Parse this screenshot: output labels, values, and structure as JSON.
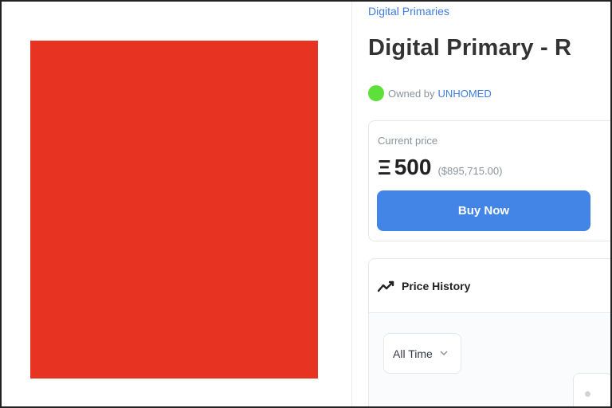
{
  "collection": {
    "name": "Digital Primaries"
  },
  "item": {
    "title": "Digital Primary - R"
  },
  "owner": {
    "prefix": "Owned by",
    "name": "UNHOMED"
  },
  "price": {
    "label": "Current price",
    "currency_symbol": "Ξ",
    "amount": "500",
    "usd": "($895,715.00)",
    "buy_label": "Buy Now"
  },
  "history": {
    "title": "Price History",
    "range_selected": "All Time"
  },
  "colors": {
    "artwork": "#e63322",
    "accent": "#4285e6",
    "link": "#3d7ddb",
    "owner_avatar": "#5ee03a"
  },
  "icons": [
    "trend-line-icon",
    "chevron-down-icon",
    "ethereum-icon"
  ]
}
